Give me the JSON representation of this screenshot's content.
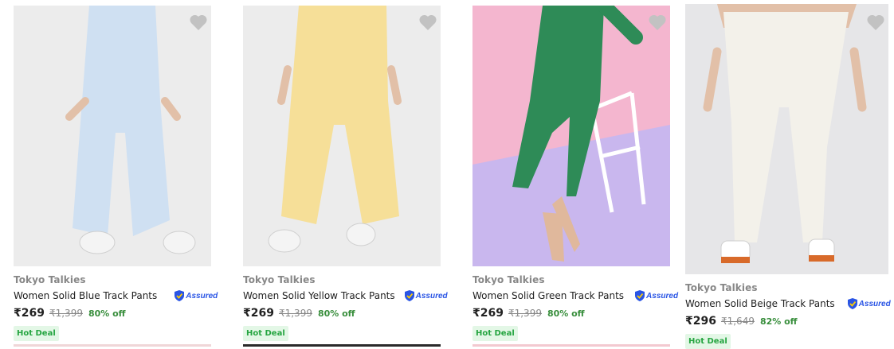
{
  "products": [
    {
      "brand": "Tokyo Talkies",
      "title": "Women Solid Blue Track Pants",
      "assured_label": "Assured",
      "price": "₹269",
      "mrp": "₹1,399",
      "discount": "80% off",
      "deal": "Hot Deal",
      "pants_color": "#cfe0f2",
      "bg_color": "#ececec"
    },
    {
      "brand": "Tokyo Talkies",
      "title": "Women Solid Yellow Track Pants",
      "assured_label": "Assured",
      "price": "₹269",
      "mrp": "₹1,399",
      "discount": "80% off",
      "deal": "Hot Deal",
      "pants_color": "#f6df98",
      "bg_color": "#ececec"
    },
    {
      "brand": "Tokyo Talkies",
      "title": "Women Solid Green Track Pants",
      "assured_label": "Assured",
      "price": "₹269",
      "mrp": "₹1,399",
      "discount": "80% off",
      "deal": "Hot Deal",
      "pants_color": "#2e8b57",
      "bg_color": "#c9b7ee"
    },
    {
      "brand": "Tokyo Talkies",
      "title": "Women Solid Beige Track Pants",
      "assured_label": "Assured",
      "price": "₹296",
      "mrp": "₹1,649",
      "discount": "82% off",
      "deal": "Hot Deal",
      "pants_color": "#f3f1ea",
      "bg_color": "#e6e6e8"
    }
  ],
  "colors": {
    "price_green": "#388e3c",
    "deal_bg": "#e3f7e6",
    "assured_blue": "#2a55e5",
    "wishlist_gray": "#c2c2c2"
  },
  "icons": {
    "wishlist": "heart-icon",
    "assured": "assured-shield-icon"
  }
}
